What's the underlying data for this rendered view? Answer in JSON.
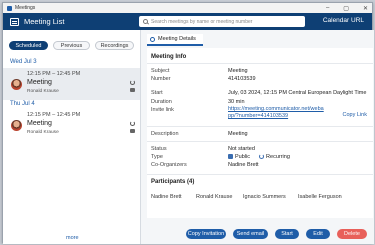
{
  "os": {
    "title": "Meetings"
  },
  "header": {
    "title": "Meeting List",
    "search_placeholder": "Search meetings by name or meeting number",
    "calendar_url": "Calendar URL"
  },
  "tabs": [
    "Scheduled",
    "Previous",
    "Recordings"
  ],
  "days": [
    {
      "label": "Wed Jul 3",
      "meetings": [
        {
          "time": "12:15 PM – 12:45 PM",
          "name": "Meeting",
          "owner": "Ronald Krause"
        }
      ]
    },
    {
      "label": "Thu Jul 4",
      "meetings": [
        {
          "time": "12:15 PM – 12:45 PM",
          "name": "Meeting",
          "owner": "Ronald Krause"
        }
      ]
    }
  ],
  "more": "more",
  "details": {
    "tab": "Meeting Details",
    "info_heading": "Meeting Info",
    "subject_label": "Subject",
    "subject": "Meeting",
    "number_label": "Number",
    "number": "414103539",
    "start_label": "Start",
    "start": "July, 03 2024, 12:15 PM Central European Daylight Time",
    "duration_label": "Duration",
    "duration": "30 min",
    "invite_label": "Invite link",
    "invite": "https://meeting.communicator.net/webapp/?number=414103539",
    "copy_link": "Copy Link",
    "description_label": "Description",
    "description": "Meeting",
    "status_label": "Status",
    "status": "Not started",
    "type_label": "Type",
    "type_public": "Public",
    "type_recurring": "Recurring",
    "coorg_label": "Co-Organizers",
    "coorg": "Nadine Brett",
    "participants_heading": "Participants (4)",
    "participants": [
      "Nadine Brett",
      "Ronald Krause",
      "Ignacio Summers",
      "Isabelle Ferguson"
    ]
  },
  "buttons": {
    "copy_invitation": "Copy Invitation",
    "send_email": "Send email",
    "start": "Start",
    "edit": "Edit",
    "delete": "Delete"
  },
  "colors": {
    "header": "#0e3f74",
    "accent": "#1f5da8",
    "delete": "#e8605a"
  }
}
